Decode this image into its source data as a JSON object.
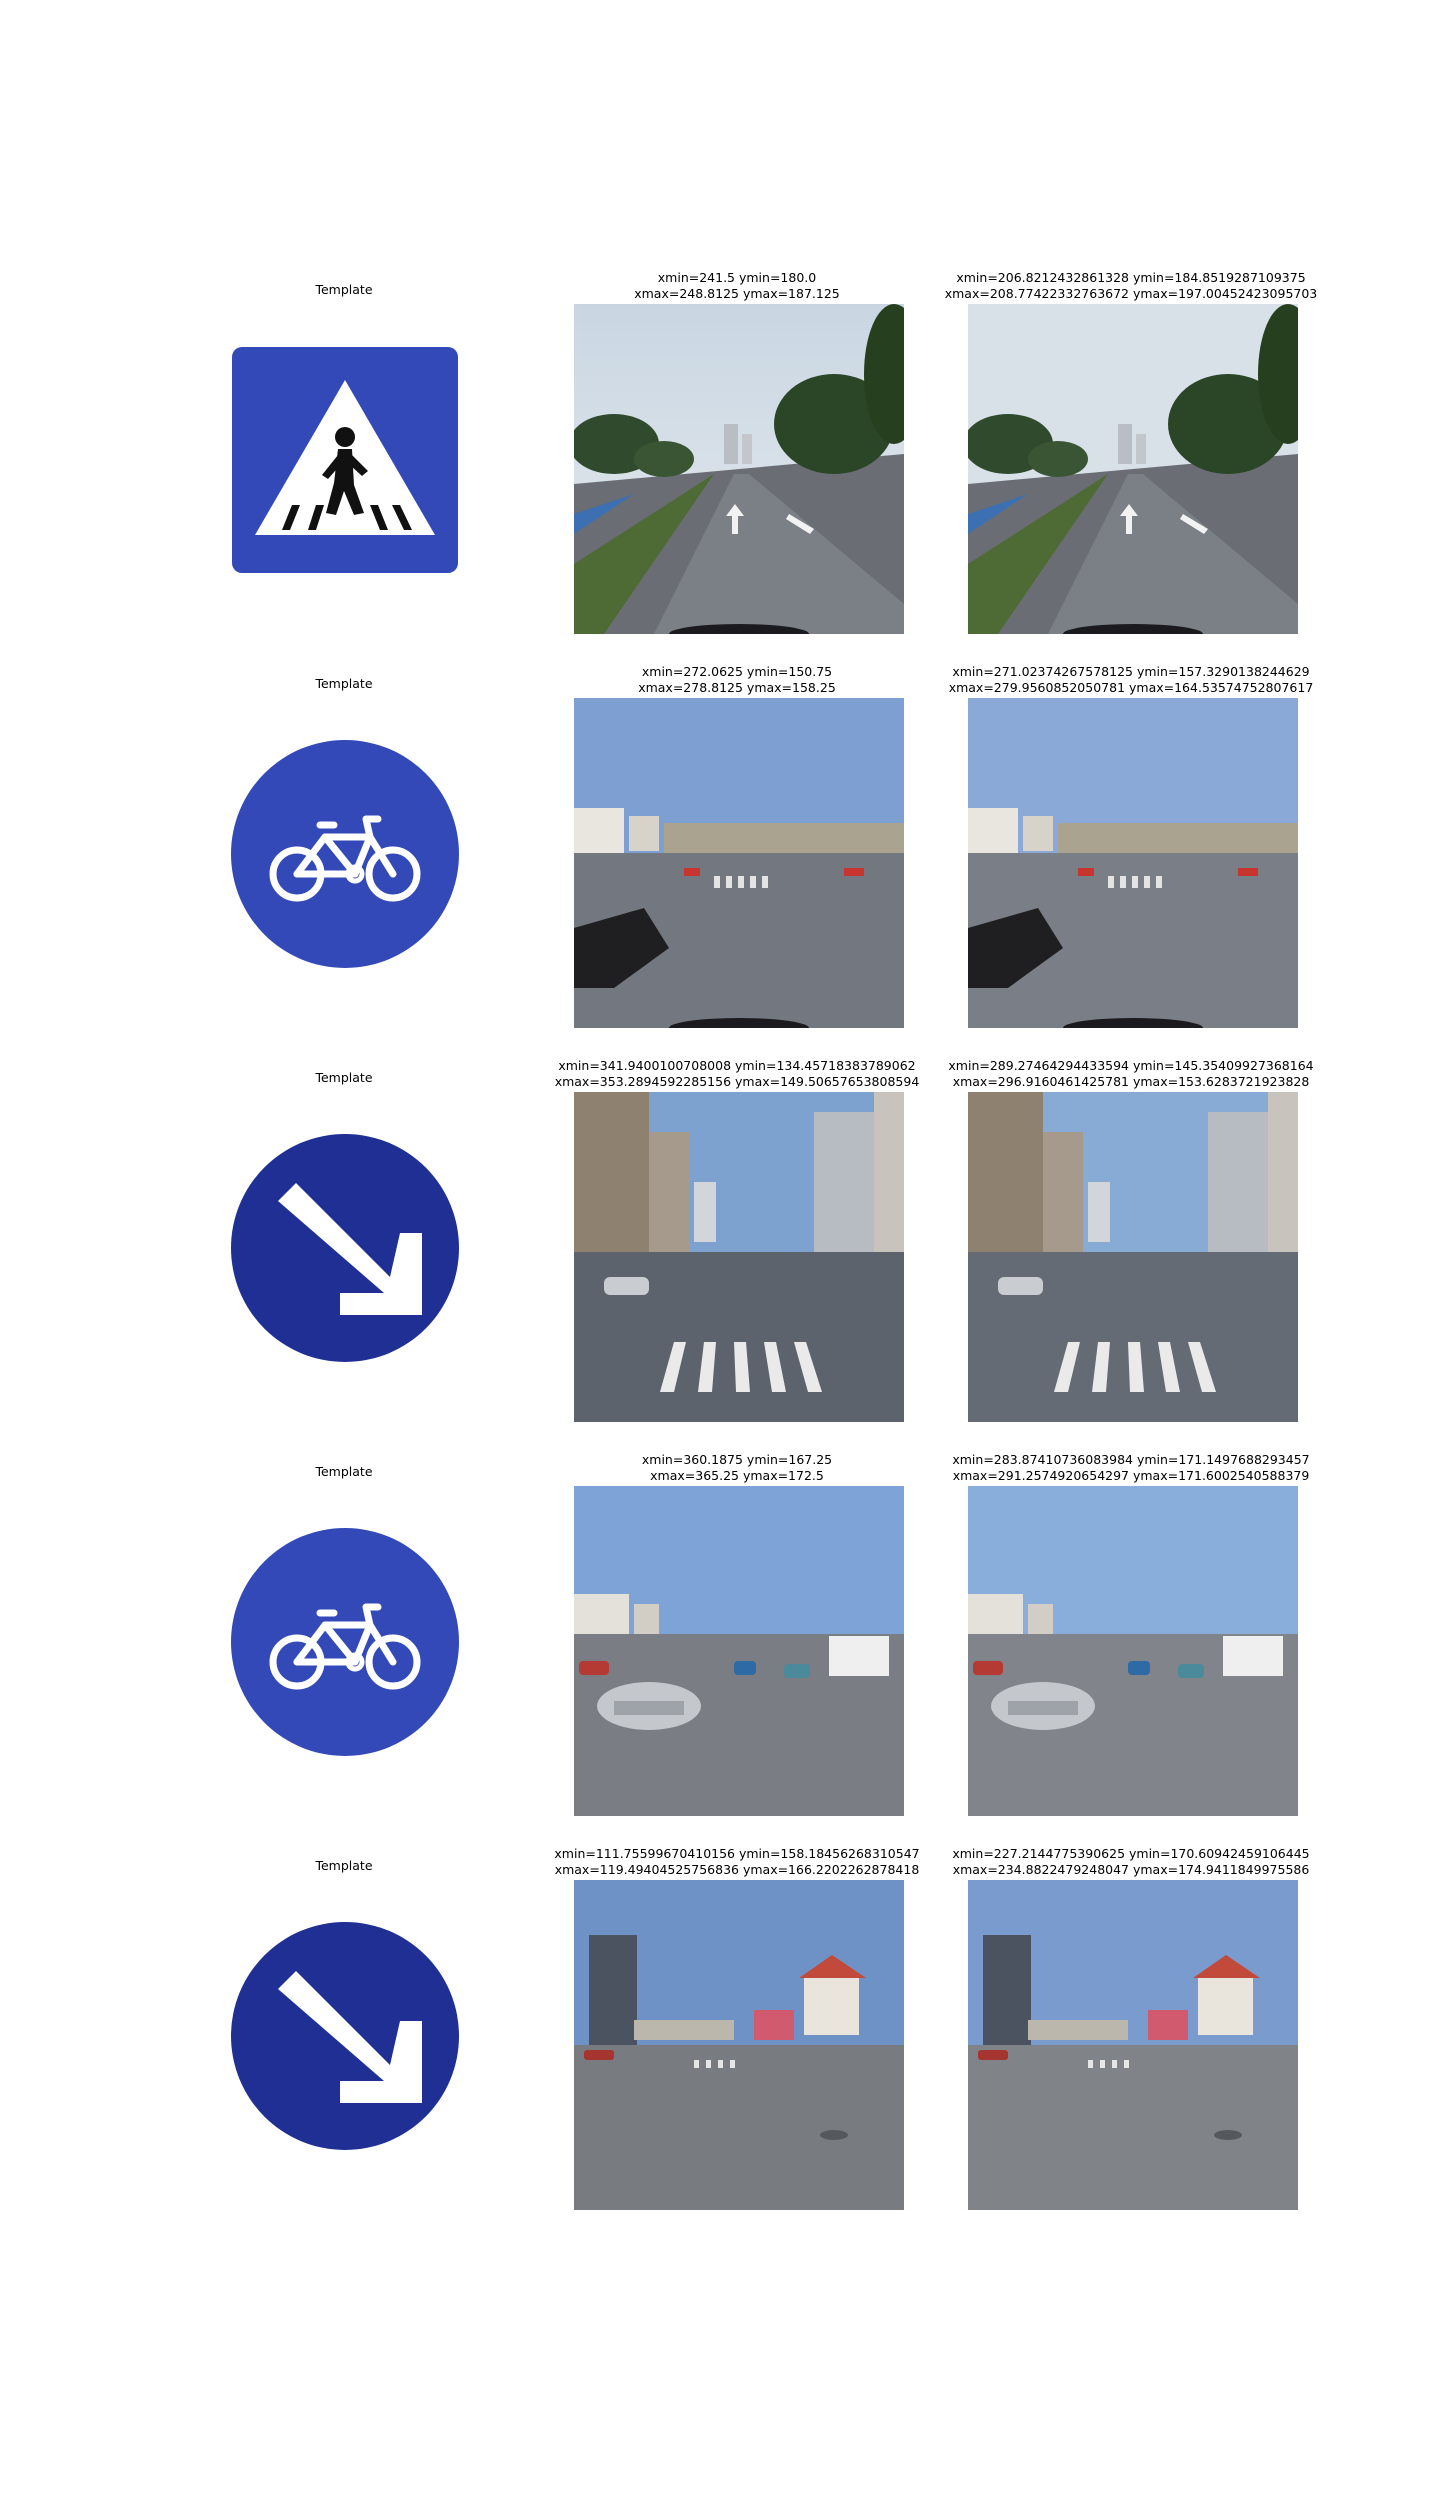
{
  "rows": [
    {
      "template_label": "Template",
      "sign": "pedestrian-crossing-sign-icon",
      "scene": "boulevard",
      "caption_a": "xmin=241.5 ymin=180.0\nxmax=248.8125 ymax=187.125",
      "caption_b": "xmin=206.8212432861328 ymin=184.8519287109375\nxmax=208.77422332763672 ymax=197.00452423095703"
    },
    {
      "template_label": "Template",
      "sign": "bicycle-lane-sign-icon",
      "scene": "intersection-suv",
      "caption_a": "xmin=272.0625 ymin=150.75\nxmax=278.8125 ymax=158.25",
      "caption_b": "xmin=271.02374267578125 ymin=157.3290138244629\nxmax=279.9560852050781 ymax=164.53574752807617"
    },
    {
      "template_label": "Template",
      "sign": "keep-right-arrow-sign-icon",
      "scene": "city-crosswalk",
      "caption_a": "xmin=341.9400100708008 ymin=134.45718383789062\nxmax=353.2894592285156 ymax=149.50657653808594",
      "caption_b": "xmin=289.27464294433594 ymin=145.35409927368164\nxmax=296.9160461425781 ymax=153.6283721923828"
    },
    {
      "template_label": "Template",
      "sign": "bicycle-lane-sign-icon",
      "scene": "intersection-silver-car",
      "caption_a": "xmin=360.1875 ymin=167.25\nxmax=365.25 ymax=172.5",
      "caption_b": "xmin=283.87410736083984 ymin=171.1497688293457\nxmax=291.2574920654297 ymax=171.6002540588379"
    },
    {
      "template_label": "Template",
      "sign": "keep-right-arrow-sign-icon",
      "scene": "junction-tower",
      "caption_a": "xmin=111.75599670410156 ymin=158.18456268310547\nxmax=119.49404525756836 ymax=166.2202262878418",
      "caption_b": "xmin=227.2144775390625 ymin=170.60942459106445\nxmax=234.8822479248047 ymax=174.9411849975586"
    }
  ],
  "colors": {
    "sign_blue": "#3349b8",
    "sign_dark_blue": "#1f2f93",
    "sky": "#9fb6d3",
    "road": "#6f7278"
  }
}
